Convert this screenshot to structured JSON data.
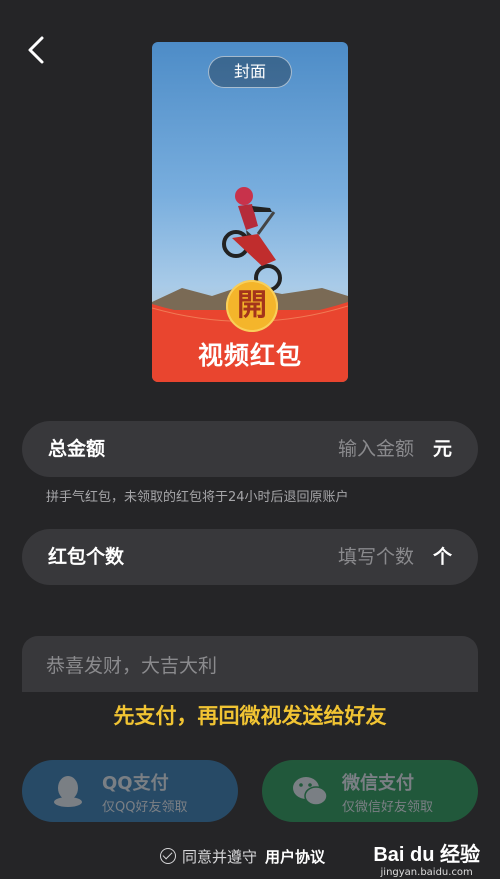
{
  "header": {
    "back_icon": "chevron-left-icon"
  },
  "cover": {
    "tag": "封面",
    "coin_char": "開",
    "title": "视频红包",
    "accent": "#e9452f",
    "coin_color": "#f4b52b"
  },
  "amount_row": {
    "label": "总金额",
    "placeholder": "输入金额",
    "unit": "元"
  },
  "hint": "拼手气红包，未领取的红包将于24小时后退回原账户",
  "count_row": {
    "label": "红包个数",
    "placeholder": "填写个数",
    "unit": "个"
  },
  "greeting": {
    "placeholder": "恭喜发财，大吉大利"
  },
  "notice": "先支付，再回微视发送给好友",
  "pay": {
    "qq": {
      "title": "QQ支付",
      "subtitle": "仅QQ好友领取",
      "icon": "qq-penguin-icon",
      "color": "#2a6fa6"
    },
    "wechat": {
      "title": "微信支付",
      "subtitle": "仅微信好友领取",
      "icon": "wechat-icon",
      "color": "#1f8c4f"
    }
  },
  "agreement": {
    "text": "同意并遵守",
    "link": "用户协议"
  },
  "watermark": {
    "brand": "Bai du 经验",
    "site": "jingyan.baidu.com"
  }
}
